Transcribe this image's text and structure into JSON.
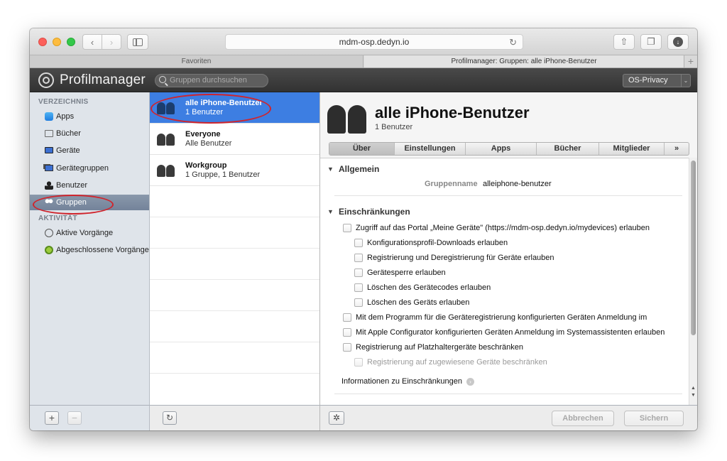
{
  "browser": {
    "url": "mdm-osp.dedyn.io",
    "favorites_tab": "Favoriten",
    "page_tab": "Profilmanager: Gruppen: alle iPhone-Benutzer",
    "new_tab": "+"
  },
  "app": {
    "title": "Profilmanager",
    "search_placeholder": "Gruppen durchsuchen",
    "org_selector": "OS-Privacy"
  },
  "sidebar": {
    "section_directory": "VERZEICHNIS",
    "items": [
      {
        "label": "Apps"
      },
      {
        "label": "Bücher"
      },
      {
        "label": "Geräte"
      },
      {
        "label": "Gerätegruppen"
      },
      {
        "label": "Benutzer"
      },
      {
        "label": "Gruppen"
      }
    ],
    "section_activity": "AKTIVITÄT",
    "activity_items": [
      {
        "label": "Aktive Vorgänge"
      },
      {
        "label": "Abgeschlossene Vorgänge"
      }
    ],
    "add_label": "+",
    "remove_label": "−"
  },
  "groups": [
    {
      "name": "alle iPhone-Benutzer",
      "sub": "1 Benutzer"
    },
    {
      "name": "Everyone",
      "sub": "Alle Benutzer"
    },
    {
      "name": "Workgroup",
      "sub": "1 Gruppe, 1 Benutzer"
    }
  ],
  "list_footer": {
    "refresh_label": "↻"
  },
  "detail": {
    "title": "alle iPhone-Benutzer",
    "subtitle": "1 Benutzer",
    "tabs": [
      "Über",
      "Einstellungen",
      "Apps",
      "Bücher",
      "Mitglieder",
      "»"
    ],
    "general": {
      "title": "Allgemein",
      "group_name_label": "Gruppenname",
      "group_name_value": "alleiphone-benutzer"
    },
    "restrictions": {
      "title": "Einschränkungen",
      "items": [
        "Zugriff auf das Portal „Meine Geräte\" (https://mdm-osp.dedyn.io/mydevices) erlauben",
        "Konfigurationsprofil-Downloads erlauben",
        "Registrierung und Deregistrierung für Geräte erlauben",
        "Gerätesperre erlauben",
        "Löschen des Gerätecodes erlauben",
        "Löschen des Geräts erlauben",
        "Mit dem Programm für die Geräteregistrierung konfigurierten Geräten Anmeldung im",
        "Mit Apple Configurator konfigurierten Geräten Anmeldung im Systemassistenten erlauben",
        "Registrierung auf Platzhaltergeräte beschränken",
        "Registrierung auf zugewiesene Geräte beschränken"
      ],
      "info_link": "Informationen zu Einschränkungen"
    },
    "cancel_label": "Abbrechen",
    "save_label": "Sichern"
  }
}
